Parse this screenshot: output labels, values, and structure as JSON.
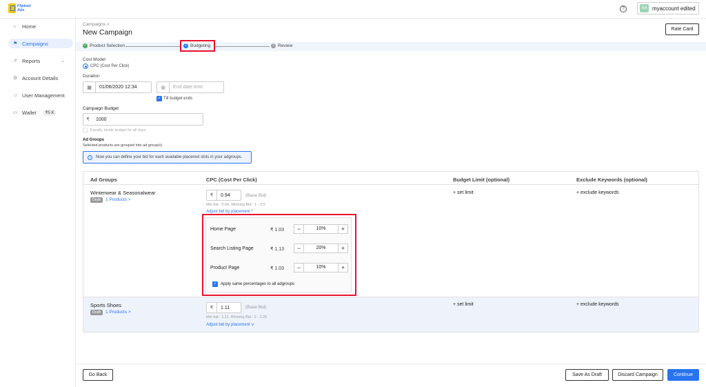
{
  "brand": {
    "line1": "Flipkart",
    "line2": "Ads"
  },
  "header": {
    "account_name": "myaccount edited",
    "avatar": "AA",
    "help": "?"
  },
  "sidebar": {
    "items": [
      {
        "label": "Home",
        "icon": "home-icon"
      },
      {
        "label": "Campaigns",
        "icon": "campaign-icon"
      },
      {
        "label": "Reports",
        "icon": "chart-icon"
      },
      {
        "label": "Account Details",
        "icon": "gear-icon"
      },
      {
        "label": "User Management",
        "icon": "user-icon"
      },
      {
        "label": "Wallet",
        "icon": "wallet-icon",
        "balance": "₹5 K"
      }
    ]
  },
  "page": {
    "breadcrumb": "Campaigns >",
    "title": "New Campaign",
    "rate_card": "Rate Card"
  },
  "steps": [
    {
      "label": "Product Selection",
      "status": "done",
      "marker": "✓"
    },
    {
      "label": "Budgeting",
      "status": "active",
      "marker": "2"
    },
    {
      "label": "Review",
      "status": "pending",
      "marker": "3"
    }
  ],
  "cost_model": {
    "label": "Cost Model",
    "option": "CPC (Cost Per Click)"
  },
  "duration": {
    "label": "Duration",
    "start_value": "01/06/2020 12:34",
    "end_placeholder": "End date time",
    "till_budget_ends": "Till budget ends"
  },
  "budget": {
    "label": "Campaign Budget",
    "currency": "₹",
    "value": "1000",
    "equally_divide": "Equally divide budget for all days"
  },
  "ad_groups": {
    "label": "Ad Groups",
    "subtitle": "Selected products are grouped into ad group(s)",
    "info": "Now you can define your bid for each available placemet slots in your adgroups."
  },
  "table": {
    "headers": [
      "Ad Groups",
      "CPC (Cost Per Click)",
      "Budget Limit (optional)",
      "Exclude Keywords (optional)"
    ],
    "rows": [
      {
        "name": "Winterwear & Seasonalwear",
        "status": "Draft",
        "products": "1 Products >",
        "bid": "0.94",
        "base_bid": "(Base Bid)",
        "bid_hint": "Min bid : 0.94, Winning Bid : 1 - 3.5",
        "adjust_link": "Adjust bid by placement ^",
        "budget_limit": "+ set limit",
        "exclude": "+ exclude keywords",
        "placements": [
          {
            "name": "Home Page",
            "price": "₹ 1.03",
            "percent": "10%"
          },
          {
            "name": "Search Listing Page",
            "price": "₹ 1.13",
            "percent": "20%"
          },
          {
            "name": "Product Page",
            "price": "₹ 1.03",
            "percent": "10%"
          }
        ],
        "apply_all": "Apply same percentages to all adgroups"
      },
      {
        "name": "Sports Shoes",
        "status": "Draft",
        "products": "1 Products >",
        "bid": "1.11",
        "base_bid": "(Base Bid)",
        "bid_hint": "Min bid : 1.11, Winning Bid : 2 - 3.25",
        "adjust_link": "Adjust bid by placement ∨",
        "budget_limit": "+ set limit",
        "exclude": "+ exclude keywords"
      }
    ]
  },
  "footer": {
    "go_back": "Go Back",
    "save_draft": "Save As Draft",
    "discard": "Discard Campaign",
    "continue": "Continue"
  },
  "colors": {
    "accent": "#2874f0",
    "highlight": "#e8102c",
    "success": "#4caf50"
  }
}
